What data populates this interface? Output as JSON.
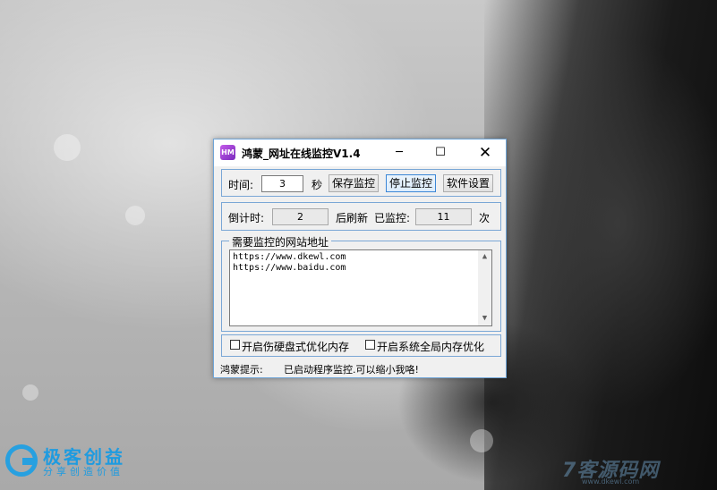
{
  "window": {
    "title": "鸿蒙_网址在线监控V1.4",
    "icon_text": "HM",
    "controls": {
      "minimize": "─",
      "maximize": "☐",
      "close": "✕"
    }
  },
  "interval": {
    "label": "时间:",
    "value": "3",
    "unit": "秒",
    "save_button": "保存监控",
    "stop_button": "停止监控",
    "settings_button": "软件设置"
  },
  "countdown": {
    "label": "倒计时:",
    "value": "2",
    "refresh_label": "后刷新",
    "monitored_label": "已监控:",
    "monitored_count": "11",
    "count_unit": "次"
  },
  "url_list": {
    "legend": "需要监控的网站地址",
    "urls": [
      "https://www.dkewl.com",
      "https://www.baidu.com"
    ]
  },
  "options": {
    "option1": {
      "label": "开启伤硬盘式优化内存",
      "checked": false
    },
    "option2": {
      "label": "开启系统全局内存优化",
      "checked": false
    }
  },
  "status": {
    "label": "鸿蒙提示:",
    "message": "已启动程序监控.可以缩小我咯!"
  },
  "watermarks": {
    "left_name": "极客创益",
    "left_slogan": "分享创造价值",
    "right_name": "7客源码网",
    "right_url": "www.dkewl.com"
  }
}
